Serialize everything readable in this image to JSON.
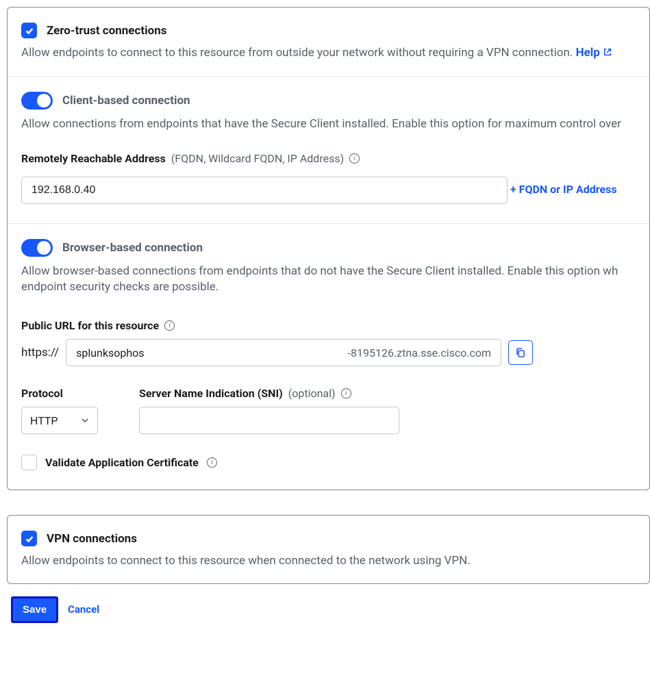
{
  "zeroTrust": {
    "title": "Zero-trust connections",
    "desc": "Allow endpoints to connect to this resource from outside your network without requiring a VPN connection.",
    "helpLabel": "Help"
  },
  "clientBased": {
    "title": "Client-based connection",
    "desc": "Allow connections from endpoints that have the Secure Client installed. Enable this option for maximum control over",
    "addressLabel": "Remotely Reachable Address",
    "addressHint": "(FQDN, Wildcard FQDN, IP Address)",
    "addressValue": "192.168.0.40",
    "addLink": "+ FQDN or IP Address"
  },
  "browserBased": {
    "title": "Browser-based connection",
    "desc": "Allow browser-based connections from endpoints that do not have the Secure Client installed. Enable this option wh endpoint security checks are possible.",
    "urlLabel": "Public URL for this resource",
    "urlPrefix": "https://",
    "urlSub": "splunksophos",
    "urlSuffix": "-8195126.ztna.sse.cisco.com",
    "protocolLabel": "Protocol",
    "protocolValue": "HTTP",
    "sniLabel": "Server Name Indication (SNI)",
    "sniOptional": "(optional)",
    "sniValue": "",
    "validateLabel": "Validate Application Certificate"
  },
  "vpn": {
    "title": "VPN connections",
    "desc": "Allow endpoints to connect to this resource when connected to the network using VPN."
  },
  "footer": {
    "save": "Save",
    "cancel": "Cancel"
  }
}
